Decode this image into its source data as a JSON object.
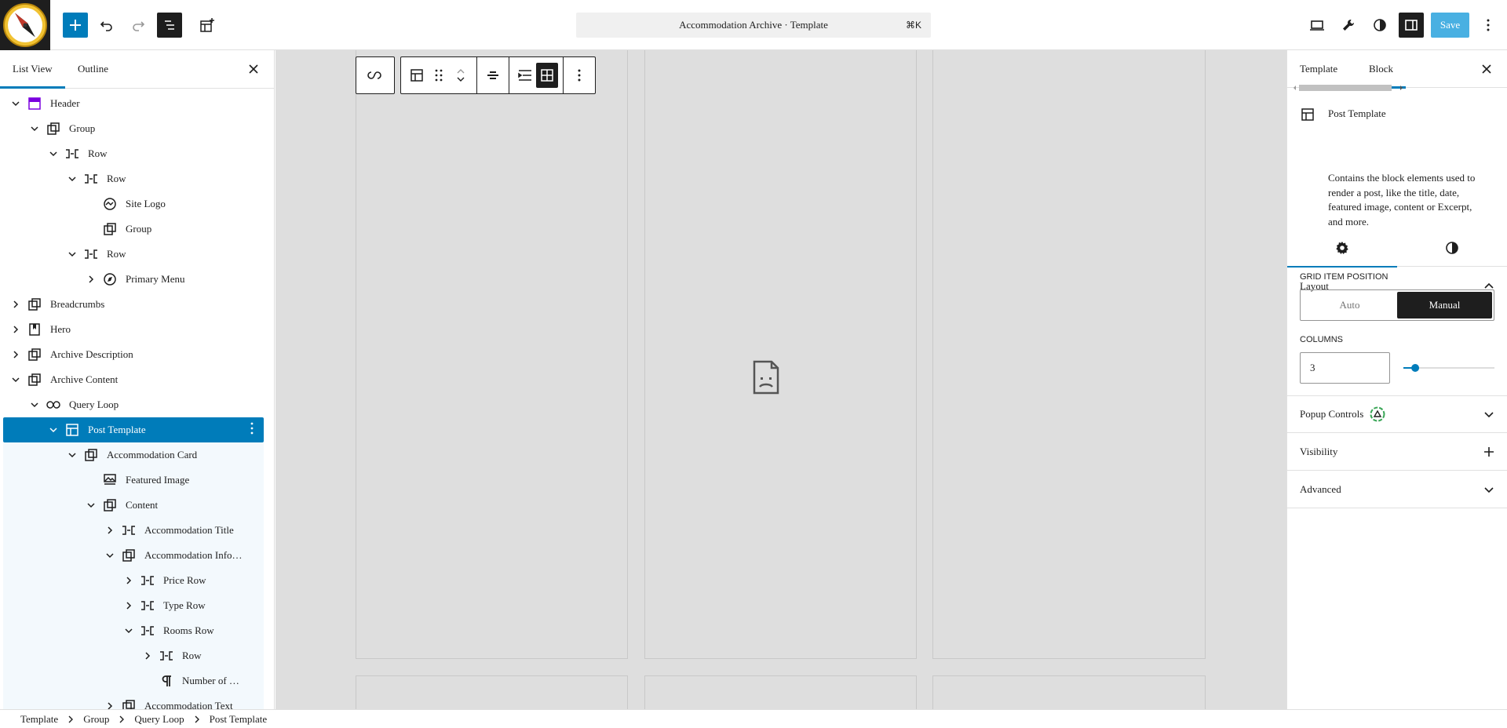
{
  "topbar": {
    "document_title": "Accommodation Archive · Template",
    "shortcut": "⌘K",
    "save_label": "Save"
  },
  "left_panel": {
    "tabs": [
      {
        "label": "List View",
        "active": true
      },
      {
        "label": "Outline",
        "active": false
      }
    ],
    "tree": [
      {
        "label": "Header",
        "depth": 0,
        "chevron": "down",
        "icon": "template-part"
      },
      {
        "label": "Group",
        "depth": 1,
        "chevron": "down",
        "icon": "group"
      },
      {
        "label": "Row",
        "depth": 2,
        "chevron": "down",
        "icon": "row"
      },
      {
        "label": "Row",
        "depth": 3,
        "chevron": "down",
        "icon": "row"
      },
      {
        "label": "Site Logo",
        "depth": 4,
        "chevron": "none",
        "icon": "site-logo"
      },
      {
        "label": "Group",
        "depth": 4,
        "chevron": "none",
        "icon": "group"
      },
      {
        "label": "Row",
        "depth": 3,
        "chevron": "down",
        "icon": "row"
      },
      {
        "label": "Primary Menu",
        "depth": 4,
        "chevron": "right",
        "icon": "navigation"
      },
      {
        "label": "Breadcrumbs",
        "depth": 0,
        "chevron": "right",
        "icon": "group"
      },
      {
        "label": "Hero",
        "depth": 0,
        "chevron": "right",
        "icon": "cover"
      },
      {
        "label": "Archive Description",
        "depth": 0,
        "chevron": "right",
        "icon": "group"
      },
      {
        "label": "Archive Content",
        "depth": 0,
        "chevron": "down",
        "icon": "group"
      },
      {
        "label": "Query Loop",
        "depth": 1,
        "chevron": "down",
        "icon": "loop"
      },
      {
        "label": "Post Template",
        "depth": 2,
        "chevron": "down",
        "icon": "post-template",
        "selected": true
      },
      {
        "label": "Accommodation Card",
        "depth": 3,
        "chevron": "down",
        "icon": "group",
        "child": true
      },
      {
        "label": "Featured Image",
        "depth": 4,
        "chevron": "none",
        "icon": "featured-image",
        "child": true
      },
      {
        "label": "Content",
        "depth": 4,
        "chevron": "down",
        "icon": "group",
        "child": true
      },
      {
        "label": "Accommodation Title",
        "depth": 5,
        "chevron": "right",
        "icon": "row",
        "child": true
      },
      {
        "label": "Accommodation Info…",
        "depth": 5,
        "chevron": "down",
        "icon": "group",
        "child": true
      },
      {
        "label": "Price Row",
        "depth": 6,
        "chevron": "right",
        "icon": "row",
        "child": true
      },
      {
        "label": "Type Row",
        "depth": 6,
        "chevron": "right",
        "icon": "row",
        "child": true
      },
      {
        "label": "Rooms Row",
        "depth": 6,
        "chevron": "down",
        "icon": "row",
        "child": true
      },
      {
        "label": "Row",
        "depth": 7,
        "chevron": "right",
        "icon": "row",
        "child": true
      },
      {
        "label": "Number of …",
        "depth": 7,
        "chevron": "none",
        "icon": "paragraph",
        "child": true
      },
      {
        "label": "Accommodation Text",
        "depth": 5,
        "chevron": "right",
        "icon": "group",
        "child": true
      }
    ]
  },
  "right_panel": {
    "tabs": [
      {
        "label": "Template",
        "active": false
      },
      {
        "label": "Block",
        "active": true
      }
    ],
    "block": {
      "title": "Post Template",
      "description": "Contains the block elements used to render a post, like the title, date, featured image, content or Excerpt, and more."
    },
    "layout": {
      "title": "Layout",
      "grid_item_position_label": "GRID ITEM POSITION",
      "options": [
        "Auto",
        "Manual"
      ],
      "selected": "Manual",
      "columns_label": "COLUMNS",
      "columns_value": "3",
      "columns_fraction": 0.13
    },
    "panels": [
      {
        "title": "Popup Controls",
        "icon": "chevron-down"
      },
      {
        "title": "Visibility",
        "icon": "plus"
      },
      {
        "title": "Advanced",
        "icon": "chevron-down"
      }
    ]
  },
  "breadcrumbs": [
    "Template",
    "Group",
    "Query Loop",
    "Post Template"
  ],
  "colors": {
    "accent": "#007cba",
    "dark": "#1e1e1e",
    "canvas": "#dedede"
  }
}
